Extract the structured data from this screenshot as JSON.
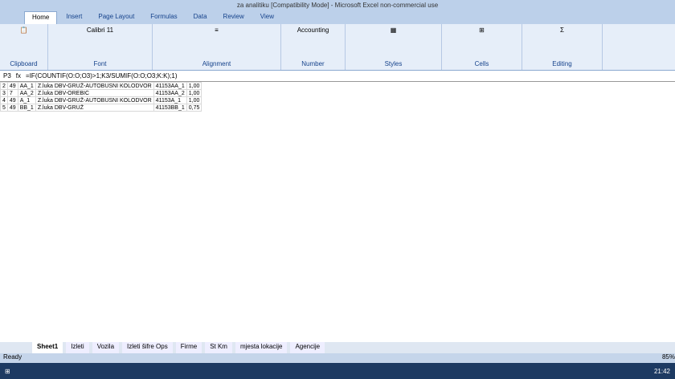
{
  "title": "za analitiku [Compatibility Mode] - Microsoft Excel non-commercial use",
  "tabs": [
    "Home",
    "Insert",
    "Page Layout",
    "Formulas",
    "Data",
    "Review",
    "View"
  ],
  "groups": [
    "Clipboard",
    "Font",
    "Alignment",
    "Number",
    "Styles",
    "Cells",
    "Editing"
  ],
  "font": "Calibri",
  "size": "11",
  "numfmt": "Accounting",
  "namebox": "P3",
  "formula": "=IF(COUNTIF(O:O;O3)>1;K3/SUMIF(O:O;O3;K:K);1)",
  "rows": [
    [
      "2",
      "49",
      "AA_1",
      "Z.luka DBV-GRUŽ-AUTOBUSNI KOLODVOR",
      "41153AA_1",
      "1,00"
    ],
    [
      "3",
      "7",
      "AA_2",
      "Z.luka DBV-OREBIĆ",
      "41153AA_2",
      "1,00"
    ],
    [
      "4",
      "49",
      "A_1",
      "Z.luka DBV-GRUŽ-AUTOBUSNI KOLODVOR",
      "41153A_1",
      "1,00"
    ],
    [
      "5",
      "49",
      "BB_1",
      "Z.luka DBV-GRUŽ",
      "41153BB_1",
      "0,75"
    ]
  ],
  "sheets": [
    "Sheet1",
    "Izleti",
    "Vozila",
    "Izleti šifre Ops",
    "Firme",
    "St Km",
    "mjesta lokacije",
    "Agencije"
  ],
  "status": "Ready",
  "zoom": "85%",
  "clock": "21:42"
}
